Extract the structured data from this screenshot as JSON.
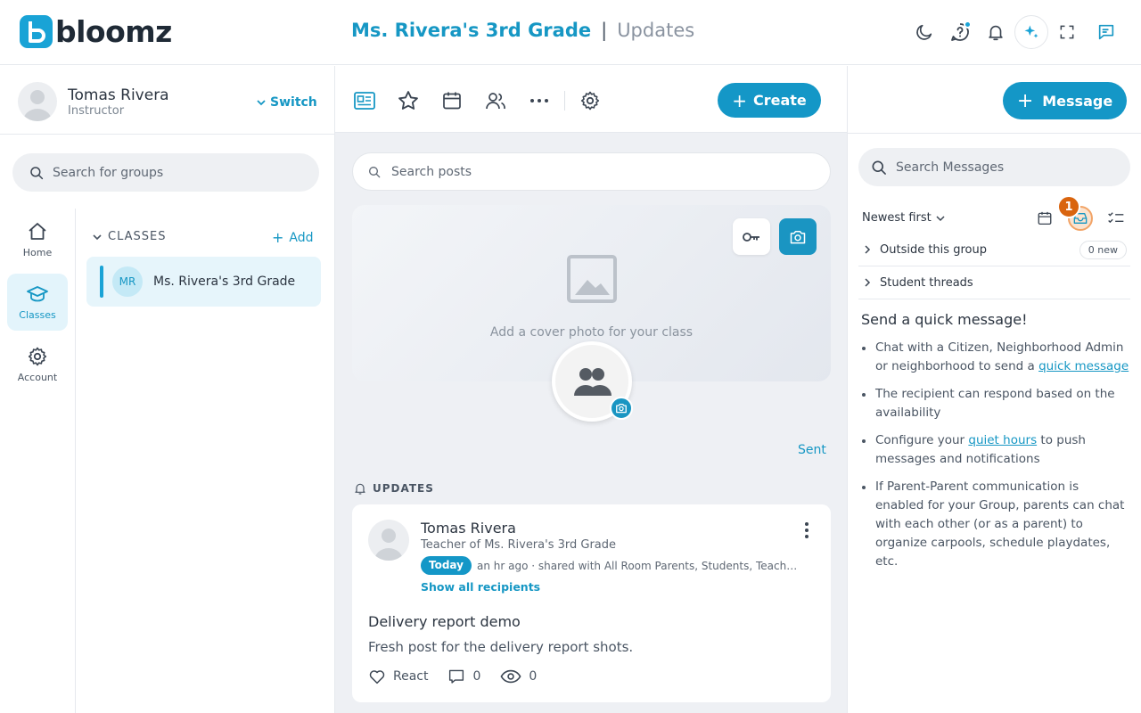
{
  "brand": {
    "logo_text": "bloomz",
    "accent": "#1497c7"
  },
  "header": {
    "class_name": "Ms. Rivera's 3rd Grade",
    "separator": "|",
    "page": "Updates"
  },
  "top_icons": [
    "moon-icon",
    "help-icon",
    "bell-icon",
    "sparkle-icon",
    "fullscreen-icon",
    "chat-icon"
  ],
  "profile": {
    "name": "Tomas Rivera",
    "role": "Instructor",
    "switch_label": "Switch"
  },
  "group_search": {
    "placeholder": "Search for groups"
  },
  "nav": [
    {
      "label": "Home",
      "icon": "home-icon"
    },
    {
      "label": "Classes",
      "icon": "graduation-cap-icon",
      "active": true
    },
    {
      "label": "Account",
      "icon": "gear-icon"
    }
  ],
  "classes": {
    "heading": "CLASSES",
    "add_label": "Add",
    "items": [
      {
        "initials": "MR",
        "name": "Ms. Rivera's 3rd Grade"
      }
    ]
  },
  "toolbar": {
    "icons": [
      "newsfeed-icon",
      "star-icon",
      "calendar-icon",
      "people-icon",
      "more-icon",
      "settings-icon"
    ],
    "create_label": "Create"
  },
  "post_search": {
    "placeholder": "Search posts"
  },
  "cover": {
    "text": "Add a cover photo for your class"
  },
  "sent_label": "Sent",
  "updates": {
    "heading": "UPDATES",
    "posts": [
      {
        "author": "Tomas Rivera",
        "role": "Teacher of Ms. Rivera's 3rd Grade",
        "badge": "Today",
        "meta": "an hr ago · shared with All Room Parents, Students, Teachers",
        "show_all": "Show all recipients",
        "title": "Delivery report demo",
        "body": "Fresh post for the delivery report shots.",
        "react_label": "React",
        "comments": "0",
        "views": "0"
      }
    ]
  },
  "messages": {
    "button_label": "Message",
    "search_placeholder": "Search Messages",
    "sort_label": "Newest first",
    "inbox_count": "1",
    "threads": [
      {
        "label": "Outside this group",
        "badge": "0 new"
      },
      {
        "label": "Student threads"
      }
    ],
    "quick": {
      "title": "Send a quick message!",
      "tip1_pre": "Chat with a Citizen, Neighborhood Admin or neighborhood to send a ",
      "tip1_link": "quick message",
      "tip2": "The recipient can respond based on the availability",
      "tip3_pre": "Configure your ",
      "tip3_link": "quiet hours",
      "tip3_post": " to push messages and notifications",
      "tip4": "If Parent-Parent communication is enabled for your Group, parents can chat with each other (or as a parent) to organize carpools, schedule playdates, etc."
    }
  }
}
